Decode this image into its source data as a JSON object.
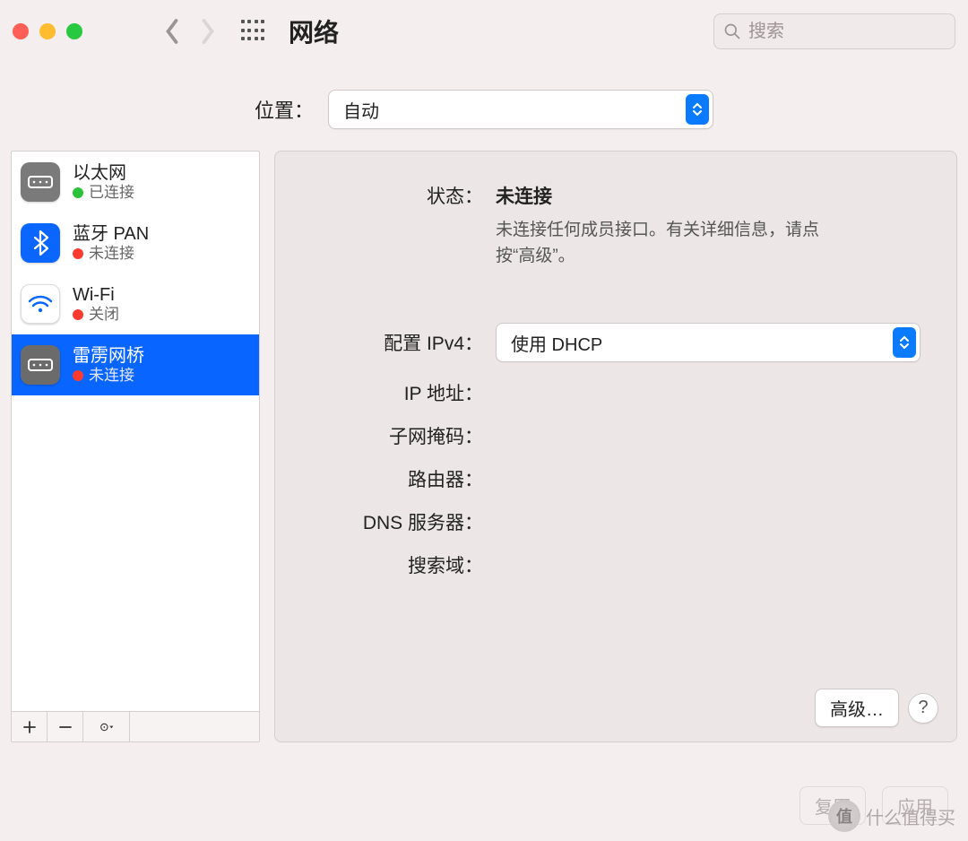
{
  "window": {
    "title": "网络",
    "search_placeholder": "搜索"
  },
  "location": {
    "label": "位置：",
    "value": "自动"
  },
  "sidebar": {
    "services": [
      {
        "name": "以太网",
        "status": "已连接",
        "status_color": "green",
        "icon": "ethernet"
      },
      {
        "name": "蓝牙 PAN",
        "status": "未连接",
        "status_color": "red",
        "icon": "bluetooth"
      },
      {
        "name": "Wi-Fi",
        "status": "关闭",
        "status_color": "red",
        "icon": "wifi"
      },
      {
        "name": "雷雳网桥",
        "status": "未连接",
        "status_color": "red",
        "icon": "thunderbolt",
        "selected": true
      }
    ]
  },
  "main": {
    "status_label": "状态：",
    "status_value": "未连接",
    "status_desc": "未连接任何成员接口。有关详细信息，请点按“高级”。",
    "ipv4_label": "配置 IPv4：",
    "ipv4_value": "使用 DHCP",
    "ip_label": "IP 地址：",
    "ip_value": "",
    "subnet_label": "子网掩码：",
    "subnet_value": "",
    "router_label": "路由器：",
    "router_value": "",
    "dns_label": "DNS 服务器：",
    "dns_value": "",
    "search_domain_label": "搜索域：",
    "search_domain_value": "",
    "advanced_button": "高级…",
    "help_button": "?"
  },
  "footer": {
    "revert": "复原",
    "apply": "应用"
  },
  "watermark": {
    "badge": "值",
    "text": "什么值得买"
  }
}
